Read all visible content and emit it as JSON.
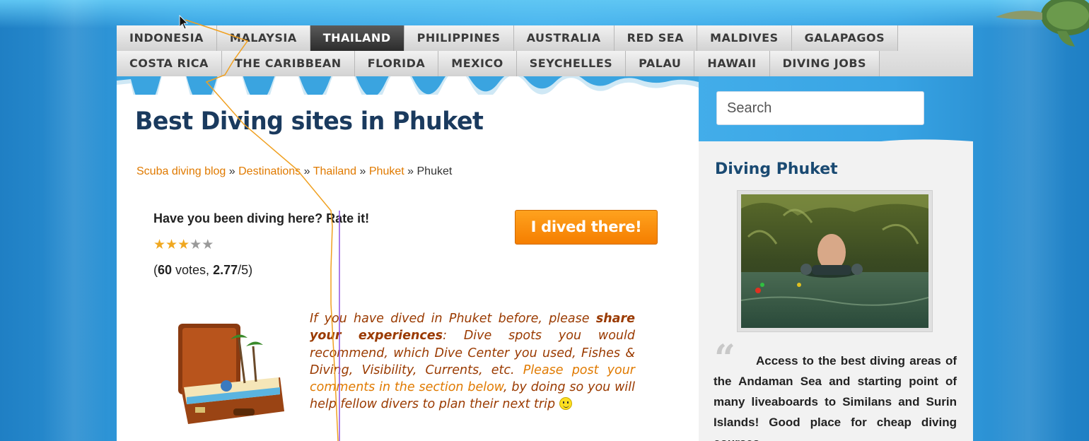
{
  "nav": {
    "row1": [
      {
        "label": "INDONESIA",
        "active": false
      },
      {
        "label": "MALAYSIA",
        "active": false
      },
      {
        "label": "THAILAND",
        "active": true
      },
      {
        "label": "PHILIPPINES",
        "active": false
      },
      {
        "label": "AUSTRALIA",
        "active": false
      },
      {
        "label": "RED SEA",
        "active": false
      },
      {
        "label": "MALDIVES",
        "active": false
      },
      {
        "label": "GALAPAGOS",
        "active": false
      }
    ],
    "row2": [
      {
        "label": "COSTA RICA",
        "active": false
      },
      {
        "label": "THE CARIBBEAN",
        "active": false
      },
      {
        "label": "FLORIDA",
        "active": false
      },
      {
        "label": "MEXICO",
        "active": false
      },
      {
        "label": "SEYCHELLES",
        "active": false
      },
      {
        "label": "PALAU",
        "active": false
      },
      {
        "label": "HAWAII",
        "active": false
      },
      {
        "label": "DIVING JOBS",
        "active": false
      }
    ]
  },
  "main": {
    "title": "Best Diving sites in Phuket",
    "breadcrumb": {
      "links": [
        "Scuba diving blog",
        "Destinations",
        "Thailand",
        "Phuket"
      ],
      "separator": "»",
      "current": "Phuket"
    },
    "rating": {
      "question": "Have you been diving here? Rate it!",
      "stars_filled": 2.77,
      "stars_max": 5,
      "votes_open": "(",
      "votes_count": "60",
      "votes_word": " votes, ",
      "score": "2.77",
      "score_suffix": "/5)"
    },
    "dive_button": "I dived there!",
    "share": {
      "part1": "If you have dived in Phuket before, please ",
      "bold": "share your experiences",
      "part2": ": Dive spots you would recommend, which Dive Center you used, Fishes & Diving, Visibility, Currents, etc. ",
      "orange": "Please post your comments in the section below",
      "part3": ", by doing so you will help fellow divers to plan their next trip "
    }
  },
  "sidebar": {
    "search_placeholder": "Search",
    "title": "Diving Phuket",
    "quote": "Access to the best diving areas of the Andaman Sea and starting point of many liveaboards to Similans and Surin Islands! Good place for cheap diving courses."
  },
  "colors": {
    "accent_orange": "#e07a00",
    "title_blue": "#1a3a5e",
    "button_orange": "#f57e00",
    "nav_active": "#2c2c2c"
  }
}
